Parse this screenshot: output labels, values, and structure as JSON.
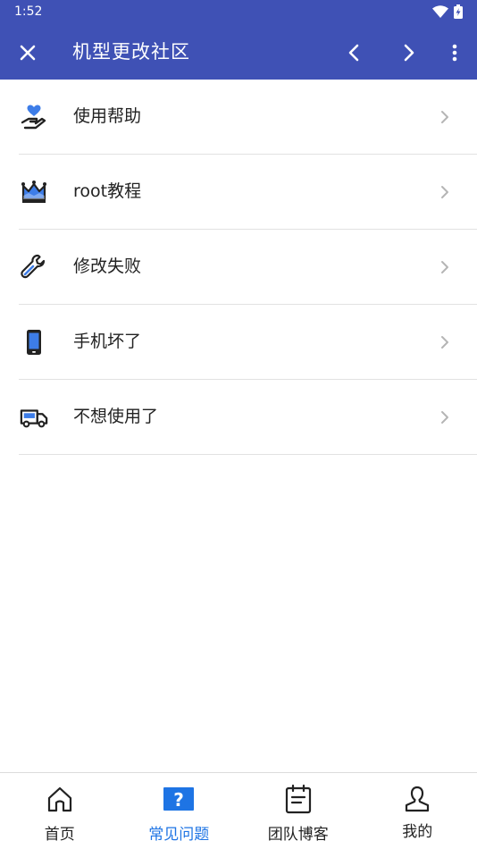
{
  "status_bar": {
    "time": "1:52"
  },
  "app_bar": {
    "title": "机型更改社区"
  },
  "menu": [
    {
      "label": "使用帮助",
      "icon": "hand-heart-icon"
    },
    {
      "label": "root教程",
      "icon": "crown-icon"
    },
    {
      "label": "修改失败",
      "icon": "wrench-icon"
    },
    {
      "label": "手机坏了",
      "icon": "smartphone-icon"
    },
    {
      "label": "不想使用了",
      "icon": "truck-icon"
    }
  ],
  "bottom_nav": [
    {
      "label": "首页",
      "icon": "home-icon"
    },
    {
      "label": "常见问题",
      "icon": "question-icon",
      "active": true
    },
    {
      "label": "团队博客",
      "icon": "notepad-icon"
    },
    {
      "label": "我的",
      "icon": "user-icon"
    }
  ],
  "colors": {
    "primary": "#3f51b5",
    "accent": "#1e74e4",
    "icon_blue": "#3d7de8"
  }
}
